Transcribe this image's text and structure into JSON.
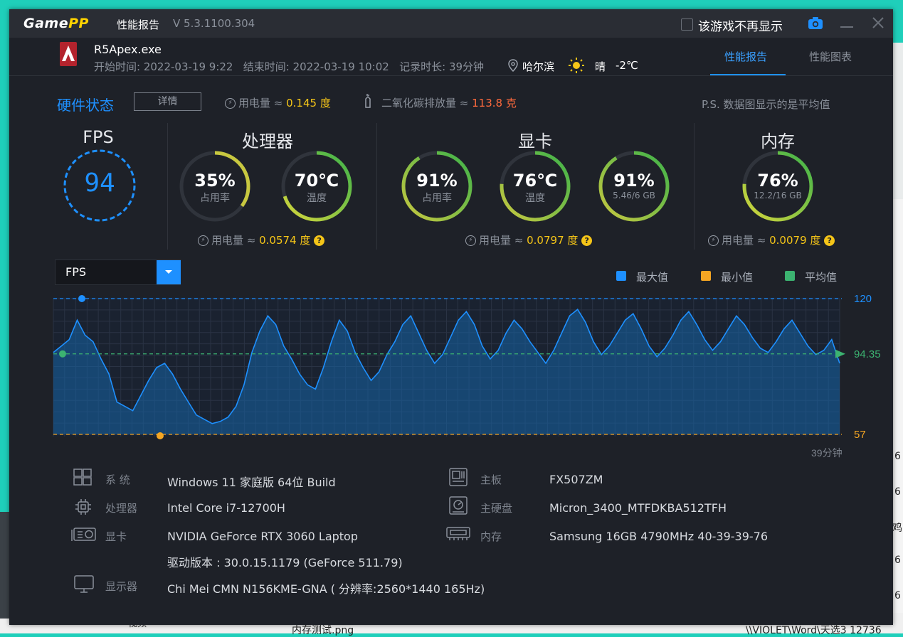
{
  "titlebar": {
    "logo_game": "Game",
    "logo_pp": "PP",
    "title": "性能报告",
    "version": "V 5.3.1100.304",
    "no_show_label": "该游戏不再显示",
    "camera_icon": "camera-icon",
    "minimize_icon": "minimize-icon",
    "close_icon": "close-icon"
  },
  "session": {
    "exe": "R5Apex.exe",
    "start_label": "开始时间:",
    "start": "2022-03-19 9:22",
    "end_label": "结束时间:",
    "end": "2022-03-19 10:02",
    "duration_label": "记录时长:",
    "duration": "39分钟",
    "location": "哈尔滨",
    "weather": "晴",
    "temperature": "-2℃"
  },
  "tabs": [
    {
      "label": "性能报告",
      "active": true
    },
    {
      "label": "性能图表",
      "active": false
    }
  ],
  "hardware": {
    "title": "硬件状态",
    "detail_button": "详情",
    "power_label": "用电量 ≈",
    "power_value": "0.145 度",
    "co2_label": "二氧化碳排放量 ≈",
    "co2_value": "113.8 克",
    "note": "P.S. 数据图显示的是平均值"
  },
  "fps": {
    "title": "FPS",
    "value": "94"
  },
  "cpu": {
    "title": "处理器",
    "usage": {
      "value": "35%",
      "label": "占用率",
      "fraction": 0.35
    },
    "temp": {
      "value": "70℃",
      "label": "温度",
      "fraction": 0.7
    },
    "power_label": "用电量 ≈",
    "power_value": "0.0574 度"
  },
  "gpu": {
    "title": "显卡",
    "usage": {
      "value": "91%",
      "label": "占用率",
      "fraction": 0.91
    },
    "temp": {
      "value": "76℃",
      "label": "温度",
      "fraction": 0.76
    },
    "vram": {
      "value": "91%",
      "label": "5.46/6 GB",
      "fraction": 0.91
    },
    "power_label": "用电量 ≈",
    "power_value": "0.0797 度"
  },
  "memory": {
    "title": "内存",
    "usage": {
      "value": "76%",
      "label": "12.2/16 GB",
      "fraction": 0.76
    },
    "power_label": "用电量 ≈",
    "power_value": "0.0079 度"
  },
  "chart_controls": {
    "metric_select": "FPS",
    "legend": [
      {
        "label": "最大值",
        "color": "#1e90ff"
      },
      {
        "label": "最小值",
        "color": "#f5a623"
      },
      {
        "label": "平均值",
        "color": "#3cb371"
      }
    ]
  },
  "chart_data": {
    "type": "area",
    "series_color": "#1e90ff",
    "duration_label": "39分钟",
    "ylim": [
      57,
      120
    ],
    "max": 120,
    "avg": 94.35,
    "min": 57,
    "max_label": "120",
    "avg_label": "94.35",
    "min_label": "57",
    "values": [
      95,
      98,
      101,
      110,
      103,
      100,
      92,
      85,
      72,
      70,
      68,
      75,
      82,
      88,
      90,
      85,
      78,
      72,
      66,
      64,
      62,
      63,
      65,
      70,
      80,
      95,
      105,
      112,
      108,
      98,
      92,
      85,
      80,
      78,
      88,
      100,
      110,
      105,
      95,
      88,
      82,
      86,
      94,
      100,
      108,
      112,
      104,
      96,
      90,
      94,
      102,
      110,
      114,
      108,
      98,
      92,
      96,
      104,
      110,
      106,
      100,
      95,
      90,
      96,
      104,
      112,
      115,
      109,
      100,
      94,
      98,
      104,
      110,
      113,
      106,
      98,
      93,
      97,
      103,
      110,
      114,
      108,
      101,
      96,
      100,
      106,
      112,
      108,
      102,
      97,
      95,
      100,
      106,
      110,
      104,
      98,
      94,
      96,
      101,
      90
    ]
  },
  "system_info": [
    {
      "icon": "windows-icon",
      "label": "系  统",
      "value": "Windows 11 家庭版 64位   Build"
    },
    {
      "icon": "cpu-icon",
      "label": "处理器",
      "value": "Intel Core i7-12700H"
    },
    {
      "icon": "gpu-icon",
      "label": "显卡",
      "value": "NVIDIA GeForce RTX 3060 Laptop"
    },
    {
      "icon": "driver-icon",
      "label": "",
      "value": "驱动版本 : 30.0.15.1179 (GeForce 511.79)"
    },
    {
      "icon": "monitor-icon",
      "label": "显示器",
      "value": "Chi Mei CMN N156KME-GNA ( 分辨率:2560*1440 165Hz)"
    },
    {
      "icon": "motherboard-icon",
      "label": "主板",
      "value": "FX507ZM"
    },
    {
      "icon": "disk-icon",
      "label": "主硬盘",
      "value": "Micron_3400_MTFDKBA512TFH"
    },
    {
      "icon": "memory-icon",
      "label": "内存",
      "value": "Samsung 16GB 4790MHz 40-39-39-76"
    }
  ],
  "background": {
    "right_numbers": [
      "6",
      "6",
      "鸡",
      "6",
      "6"
    ],
    "bottom_file": "内存测试.png",
    "bottom_path": "\\\\VIOLET\\Word\\天选3 12736",
    "bottom_left": "视频"
  }
}
